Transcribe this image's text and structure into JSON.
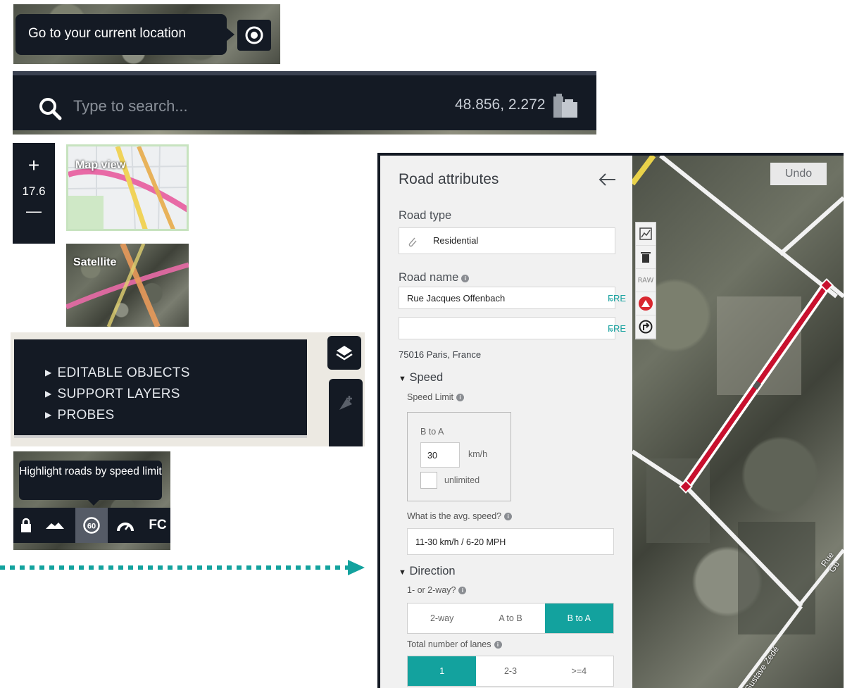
{
  "location_tooltip": {
    "text": "Go to your current location"
  },
  "search": {
    "placeholder": "Type to search...",
    "coordinates": "48.856, 2.272"
  },
  "zoom": {
    "plus": "+",
    "level": "17.6",
    "minus": "—"
  },
  "basemaps": {
    "map_view": "Map view",
    "satellite": "Satellite"
  },
  "layers": {
    "items": [
      "EDITABLE OBJECTS",
      "SUPPORT LAYERS",
      "PROBES"
    ],
    "arrow": "▶"
  },
  "speed_tooltip": {
    "text": "Highlight roads by speed limit"
  },
  "toolbar": {
    "fc_label": "FC",
    "speed_badge": "60"
  },
  "road": {
    "title": "Road attributes",
    "road_type_label": "Road type",
    "road_type_value": "Residential",
    "road_name_label": "Road name",
    "road_name_value": "Rue Jacques Offenbach",
    "lang": "FRE",
    "address": "75016 Paris, France",
    "speed_section": "Speed",
    "speed_limit_label": "Speed Limit",
    "direction_label": "B to A",
    "speed_value": "30",
    "speed_unit": "km/h",
    "unlimited_label": "unlimited",
    "avg_speed_question": "What is the avg. speed?",
    "avg_speed_value": "11-30 km/h / 6-20 MPH",
    "direction_section": "Direction",
    "way_question": "1- or 2-way?",
    "way_options": [
      "2-way",
      "A to B",
      "B to A"
    ],
    "way_selected": "B to A",
    "lanes_question": "Total number of lanes",
    "lane_options": [
      "1",
      "2-3",
      ">=4"
    ],
    "lane_selected": "1"
  },
  "map": {
    "undo": "Undo",
    "raw": "RAW",
    "street_1": "Rue Gu",
    "street_2": "Gustave Zedé"
  },
  "colors": {
    "panel_dark": "#141a24",
    "teal": "#13a29e",
    "road_red": "#c8102e"
  }
}
